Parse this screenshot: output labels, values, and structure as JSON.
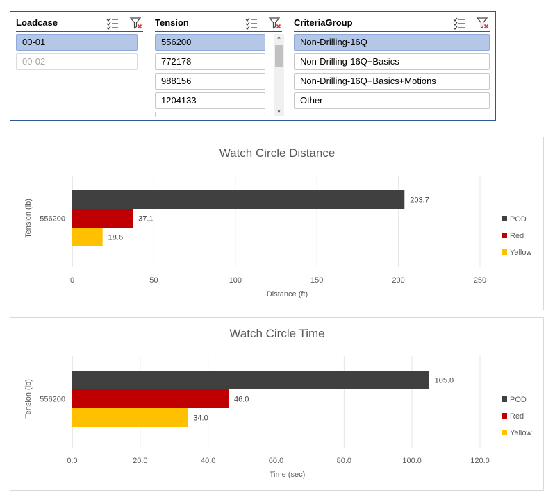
{
  "slicers": [
    {
      "title": "Loadcase",
      "items": [
        {
          "label": "00-01",
          "state": "selected"
        },
        {
          "label": "00-02",
          "state": "dim"
        }
      ]
    },
    {
      "title": "Tension",
      "items": [
        {
          "label": "556200",
          "state": "selected"
        },
        {
          "label": "772178",
          "state": "normal"
        },
        {
          "label": "988156",
          "state": "normal"
        },
        {
          "label": "1204133",
          "state": "normal"
        }
      ],
      "scroll": {
        "up_glyph": "^",
        "down_glyph": "v"
      }
    },
    {
      "title": "CriteriaGroup",
      "items": [
        {
          "label": "Non-Drilling-16Q",
          "state": "selected"
        },
        {
          "label": "Non-Drilling-16Q+Basics",
          "state": "normal"
        },
        {
          "label": "Non-Drilling-16Q+Basics+Motions",
          "state": "normal"
        },
        {
          "label": "Other",
          "state": "normal"
        }
      ]
    }
  ],
  "colors": {
    "pod": "#404040",
    "red": "#c00000",
    "yellow": "#ffc000",
    "slicer_border": "#2f5597",
    "selected_fill": "#b4c7e7"
  },
  "chart_data": [
    {
      "type": "bar",
      "orientation": "horizontal",
      "title": "Watch Circle Distance",
      "xlabel": "Distance (ft)",
      "ylabel": "Tension (lb)",
      "categories": [
        "556200"
      ],
      "series": [
        {
          "name": "POD",
          "values": [
            203.7
          ],
          "color": "#404040",
          "label": "203.7"
        },
        {
          "name": "Red",
          "values": [
            37.1
          ],
          "color": "#c00000",
          "label": "37.1"
        },
        {
          "name": "Yellow",
          "values": [
            18.6
          ],
          "color": "#ffc000",
          "label": "18.6"
        }
      ],
      "xlim": [
        0,
        250
      ],
      "xticks": [
        "0",
        "50",
        "100",
        "150",
        "200",
        "250"
      ],
      "grid": true,
      "legend": "right"
    },
    {
      "type": "bar",
      "orientation": "horizontal",
      "title": "Watch Circle Time",
      "xlabel": "Time (sec)",
      "ylabel": "Tension (lb)",
      "categories": [
        "556200"
      ],
      "series": [
        {
          "name": "POD",
          "values": [
            105.0
          ],
          "color": "#404040",
          "label": "105.0"
        },
        {
          "name": "Red",
          "values": [
            46.0
          ],
          "color": "#c00000",
          "label": "46.0"
        },
        {
          "name": "Yellow",
          "values": [
            34.0
          ],
          "color": "#ffc000",
          "label": "34.0"
        }
      ],
      "xlim": [
        0,
        120
      ],
      "xticks": [
        "0.0",
        "20.0",
        "40.0",
        "60.0",
        "80.0",
        "100.0",
        "120.0"
      ],
      "grid": true,
      "legend": "right"
    }
  ]
}
